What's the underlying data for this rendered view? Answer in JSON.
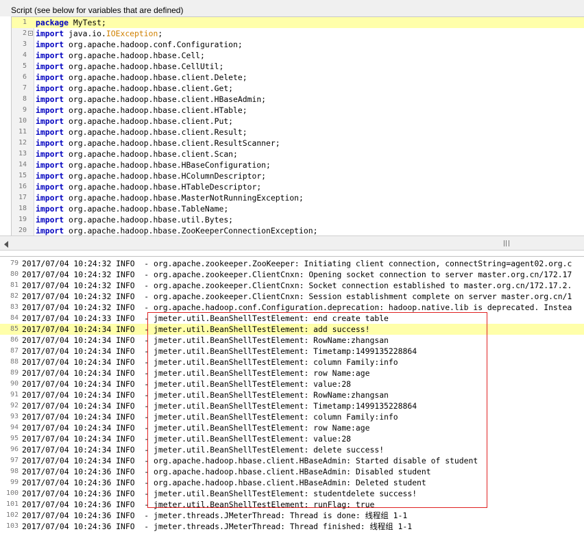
{
  "panel": {
    "title": "Script (see below for variables that are defined)"
  },
  "editor": {
    "lines": [
      {
        "n": "1",
        "kw": "package",
        "rest": " MyTest;",
        "cls": "",
        "tail": ""
      },
      {
        "n": "2",
        "kw": "import",
        "rest": " java.io.",
        "cls": "IOException",
        "tail": ";"
      },
      {
        "n": "3",
        "kw": "import",
        "rest": " org.apache.hadoop.conf.Configuration;",
        "cls": "",
        "tail": ""
      },
      {
        "n": "4",
        "kw": "import",
        "rest": " org.apache.hadoop.hbase.Cell;",
        "cls": "",
        "tail": ""
      },
      {
        "n": "5",
        "kw": "import",
        "rest": " org.apache.hadoop.hbase.CellUtil;",
        "cls": "",
        "tail": ""
      },
      {
        "n": "6",
        "kw": "import",
        "rest": " org.apache.hadoop.hbase.client.Delete;",
        "cls": "",
        "tail": ""
      },
      {
        "n": "7",
        "kw": "import",
        "rest": " org.apache.hadoop.hbase.client.Get;",
        "cls": "",
        "tail": ""
      },
      {
        "n": "8",
        "kw": "import",
        "rest": " org.apache.hadoop.hbase.client.HBaseAdmin;",
        "cls": "",
        "tail": ""
      },
      {
        "n": "9",
        "kw": "import",
        "rest": " org.apache.hadoop.hbase.client.HTable;",
        "cls": "",
        "tail": ""
      },
      {
        "n": "10",
        "kw": "import",
        "rest": " org.apache.hadoop.hbase.client.Put;",
        "cls": "",
        "tail": ""
      },
      {
        "n": "11",
        "kw": "import",
        "rest": " org.apache.hadoop.hbase.client.Result;",
        "cls": "",
        "tail": ""
      },
      {
        "n": "12",
        "kw": "import",
        "rest": " org.apache.hadoop.hbase.client.ResultScanner;",
        "cls": "",
        "tail": ""
      },
      {
        "n": "13",
        "kw": "import",
        "rest": " org.apache.hadoop.hbase.client.Scan;",
        "cls": "",
        "tail": ""
      },
      {
        "n": "14",
        "kw": "import",
        "rest": " org.apache.hadoop.hbase.HBaseConfiguration;",
        "cls": "",
        "tail": ""
      },
      {
        "n": "15",
        "kw": "import",
        "rest": " org.apache.hadoop.hbase.HColumnDescriptor;",
        "cls": "",
        "tail": ""
      },
      {
        "n": "16",
        "kw": "import",
        "rest": " org.apache.hadoop.hbase.HTableDescriptor;",
        "cls": "",
        "tail": ""
      },
      {
        "n": "17",
        "kw": "import",
        "rest": " org.apache.hadoop.hbase.MasterNotRunningException;",
        "cls": "",
        "tail": ""
      },
      {
        "n": "18",
        "kw": "import",
        "rest": " org.apache.hadoop.hbase.TableName;",
        "cls": "",
        "tail": ""
      },
      {
        "n": "19",
        "kw": "import",
        "rest": " org.apache.hadoop.hbase.util.Bytes;",
        "cls": "",
        "tail": ""
      },
      {
        "n": "20",
        "kw": "import",
        "rest": " org.apache.hadoop.hbase.ZooKeeperConnectionException;",
        "cls": "",
        "tail": ""
      }
    ]
  },
  "log": {
    "lines": [
      {
        "n": "79",
        "text": "2017/07/04 10:24:32 INFO  - org.apache.zookeeper.ZooKeeper: Initiating client connection, connectString=agent02.org.c"
      },
      {
        "n": "80",
        "text": "2017/07/04 10:24:32 INFO  - org.apache.zookeeper.ClientCnxn: Opening socket connection to server master.org.cn/172.17"
      },
      {
        "n": "81",
        "text": "2017/07/04 10:24:32 INFO  - org.apache.zookeeper.ClientCnxn: Socket connection established to master.org.cn/172.17.2."
      },
      {
        "n": "82",
        "text": "2017/07/04 10:24:32 INFO  - org.apache.zookeeper.ClientCnxn: Session establishment complete on server master.org.cn/1"
      },
      {
        "n": "83",
        "text": "2017/07/04 10:24:32 INFO  - org.apache.hadoop.conf.Configuration.deprecation: hadoop.native.lib is deprecated. Instea"
      },
      {
        "n": "84",
        "text": "2017/07/04 10:24:33 INFO  - jmeter.util.BeanShellTestElement: end create table"
      },
      {
        "n": "85",
        "text": "2017/07/04 10:24:34 INFO  - jmeter.util.BeanShellTestElement: add success!"
      },
      {
        "n": "86",
        "text": "2017/07/04 10:24:34 INFO  - jmeter.util.BeanShellTestElement: RowName:zhangsan"
      },
      {
        "n": "87",
        "text": "2017/07/04 10:24:34 INFO  - jmeter.util.BeanShellTestElement: Timetamp:1499135228864"
      },
      {
        "n": "88",
        "text": "2017/07/04 10:24:34 INFO  - jmeter.util.BeanShellTestElement: column Family:info"
      },
      {
        "n": "89",
        "text": "2017/07/04 10:24:34 INFO  - jmeter.util.BeanShellTestElement: row Name:age"
      },
      {
        "n": "90",
        "text": "2017/07/04 10:24:34 INFO  - jmeter.util.BeanShellTestElement: value:28"
      },
      {
        "n": "91",
        "text": "2017/07/04 10:24:34 INFO  - jmeter.util.BeanShellTestElement: RowName:zhangsan"
      },
      {
        "n": "92",
        "text": "2017/07/04 10:24:34 INFO  - jmeter.util.BeanShellTestElement: Timetamp:1499135228864"
      },
      {
        "n": "93",
        "text": "2017/07/04 10:24:34 INFO  - jmeter.util.BeanShellTestElement: column Family:info"
      },
      {
        "n": "94",
        "text": "2017/07/04 10:24:34 INFO  - jmeter.util.BeanShellTestElement: row Name:age"
      },
      {
        "n": "95",
        "text": "2017/07/04 10:24:34 INFO  - jmeter.util.BeanShellTestElement: value:28"
      },
      {
        "n": "96",
        "text": "2017/07/04 10:24:34 INFO  - jmeter.util.BeanShellTestElement: delete success!"
      },
      {
        "n": "97",
        "text": "2017/07/04 10:24:34 INFO  - org.apache.hadoop.hbase.client.HBaseAdmin: Started disable of student"
      },
      {
        "n": "98",
        "text": "2017/07/04 10:24:36 INFO  - org.apache.hadoop.hbase.client.HBaseAdmin: Disabled student"
      },
      {
        "n": "99",
        "text": "2017/07/04 10:24:36 INFO  - org.apache.hadoop.hbase.client.HBaseAdmin: Deleted student"
      },
      {
        "n": "100",
        "text": "2017/07/04 10:24:36 INFO  - jmeter.util.BeanShellTestElement: studentdelete success!"
      },
      {
        "n": "101",
        "text": "2017/07/04 10:24:36 INFO  - jmeter.util.BeanShellTestElement: runFlag: true"
      },
      {
        "n": "102",
        "text": "2017/07/04 10:24:36 INFO  - jmeter.threads.JMeterThread: Thread is done: 线程组 1-1"
      },
      {
        "n": "103",
        "text": "2017/07/04 10:24:36 INFO  - jmeter.threads.JMeterThread: Thread finished: 线程组 1-1"
      }
    ]
  },
  "colors": {
    "highlight": "#ffffaa",
    "keyword": "#0000c0",
    "class_ref": "#d08000",
    "selection_box": "#e02020"
  },
  "icons": {
    "fold": "minus-box-icon",
    "scroll_left": "arrow-left-icon",
    "splitter": "grip-icon"
  }
}
